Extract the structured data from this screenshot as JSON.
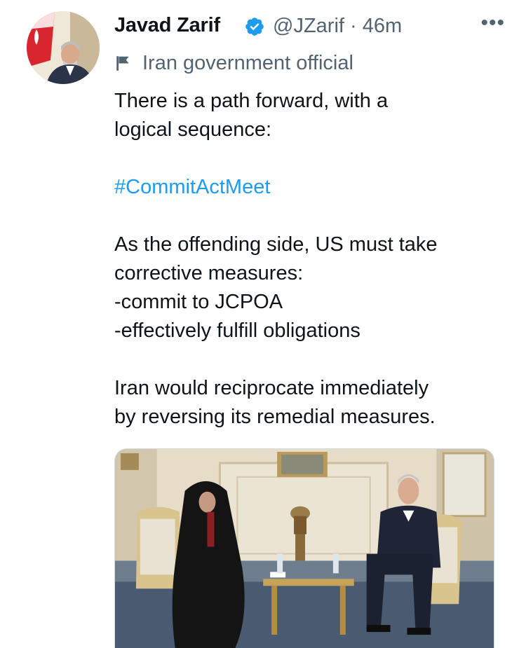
{
  "author": {
    "display_name": "Javad Zarif",
    "handle": "@JZarif",
    "separator": "·",
    "time": "46m",
    "label": "Iran government official"
  },
  "tweet": {
    "line1": "There is a path forward, with a",
    "line2": "logical sequence:",
    "hashtag": "#CommitActMeet",
    "line3": "As the offending side, US must take",
    "line4": "corrective measures:",
    "line5": "-commit to JCPOA",
    "line6": "-effectively fulfill obligations",
    "line7": "Iran would reciprocate immediately",
    "line8": "by reversing its remedial measures."
  },
  "colors": {
    "link": "#1d9bf0",
    "secondary_text": "#536471",
    "verified": "#1d9bf0"
  },
  "icons": {
    "more": "more-options-icon",
    "verified": "verified-badge-icon",
    "label": "flag-icon"
  }
}
